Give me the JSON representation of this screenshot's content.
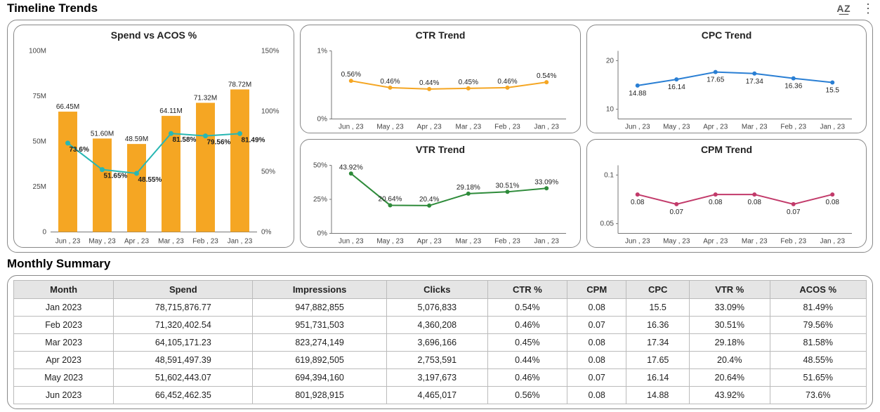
{
  "sections": {
    "trends_title": "Timeline Trends",
    "summary_title": "Monthly Summary"
  },
  "toolbar": {
    "sort_icon_label": "A͟Z",
    "more_icon_label": "⋮"
  },
  "table": {
    "headers": [
      "Month",
      "Spend",
      "Impressions",
      "Clicks",
      "CTR %",
      "CPM",
      "CPC",
      "VTR %",
      "ACOS %"
    ],
    "rows": [
      [
        "Jan 2023",
        "78,715,876.77",
        "947,882,855",
        "5,076,833",
        "0.54%",
        "0.08",
        "15.5",
        "33.09%",
        "81.49%"
      ],
      [
        "Feb 2023",
        "71,320,402.54",
        "951,731,503",
        "4,360,208",
        "0.46%",
        "0.07",
        "16.36",
        "30.51%",
        "79.56%"
      ],
      [
        "Mar 2023",
        "64,105,171.23",
        "823,274,149",
        "3,696,166",
        "0.45%",
        "0.08",
        "17.34",
        "29.18%",
        "81.58%"
      ],
      [
        "Apr 2023",
        "48,591,497.39",
        "619,892,505",
        "2,753,591",
        "0.44%",
        "0.08",
        "17.65",
        "20.4%",
        "48.55%"
      ],
      [
        "May 2023",
        "51,602,443.07",
        "694,394,160",
        "3,197,673",
        "0.46%",
        "0.07",
        "16.14",
        "20.64%",
        "51.65%"
      ],
      [
        "Jun 2023",
        "66,452,462.35",
        "801,928,915",
        "4,465,017",
        "0.56%",
        "0.08",
        "14.88",
        "43.92%",
        "73.6%"
      ]
    ]
  },
  "chart_data": [
    {
      "id": "ctr",
      "title": "CTR Trend",
      "type": "line",
      "color": "#f5a623",
      "categories": [
        "Jun , 23",
        "May , 23",
        "Apr , 23",
        "Mar , 23",
        "Feb , 23",
        "Jan , 23"
      ],
      "values": [
        0.56,
        0.46,
        0.44,
        0.45,
        0.46,
        0.54
      ],
      "value_labels": [
        "0.56%",
        "0.46%",
        "0.44%",
        "0.45%",
        "0.46%",
        "0.54%"
      ],
      "y_ticks": [
        0,
        1
      ],
      "y_tick_labels": [
        "0%",
        "1%"
      ],
      "ylim": [
        0,
        1
      ]
    },
    {
      "id": "cpc",
      "title": "CPC Trend",
      "type": "line",
      "color": "#2a7fd4",
      "categories": [
        "Jun , 23",
        "May , 23",
        "Apr , 23",
        "Mar , 23",
        "Feb , 23",
        "Jan , 23"
      ],
      "values": [
        14.88,
        16.14,
        17.65,
        17.34,
        16.36,
        15.5
      ],
      "value_labels": [
        "14.88",
        "16.14",
        "17.65",
        "17.34",
        "16.36",
        "15.5"
      ],
      "y_ticks": [
        10,
        20
      ],
      "y_tick_labels": [
        "10",
        "20"
      ],
      "ylim": [
        8,
        22
      ]
    },
    {
      "id": "vtr",
      "title": "VTR Trend",
      "type": "line",
      "color": "#2e8b3a",
      "categories": [
        "Jun , 23",
        "May , 23",
        "Apr , 23",
        "Mar , 23",
        "Feb , 23",
        "Jan , 23"
      ],
      "values": [
        43.92,
        20.64,
        20.4,
        29.18,
        30.51,
        33.09
      ],
      "value_labels": [
        "43.92%",
        "20.64%",
        "20.4%",
        "29.18%",
        "30.51%",
        "33.09%"
      ],
      "y_ticks": [
        0,
        25,
        50
      ],
      "y_tick_labels": [
        "0%",
        "25%",
        "50%"
      ],
      "ylim": [
        0,
        50
      ]
    },
    {
      "id": "cpm",
      "title": "CPM Trend",
      "type": "line",
      "color": "#c23a6a",
      "categories": [
        "Jun , 23",
        "May , 23",
        "Apr , 23",
        "Mar , 23",
        "Feb , 23",
        "Jan , 23"
      ],
      "values": [
        0.08,
        0.07,
        0.08,
        0.08,
        0.07,
        0.08
      ],
      "value_labels": [
        "0.08",
        "0.07",
        "0.08",
        "0.08",
        "0.07",
        "0.08"
      ],
      "y_ticks": [
        0.05,
        0.1
      ],
      "y_tick_labels": [
        "0.05",
        "0.1"
      ],
      "ylim": [
        0.04,
        0.11
      ]
    },
    {
      "id": "combo",
      "title": "Spend vs ACOS %",
      "type": "bar+line",
      "categories": [
        "Jun , 23",
        "May , 23",
        "Apr , 23",
        "Mar , 23",
        "Feb , 23",
        "Jan , 23"
      ],
      "bar_values": [
        66.45,
        51.6,
        48.59,
        64.11,
        71.32,
        78.72
      ],
      "bar_labels": [
        "66.45M",
        "51.60M",
        "48.59M",
        "64.11M",
        "71.32M",
        "78.72M"
      ],
      "bar_ylim": [
        0,
        100
      ],
      "bar_y_ticks": [
        0,
        25,
        50,
        75,
        100
      ],
      "bar_y_tick_labels": [
        "0",
        "25M",
        "50M",
        "75M",
        "100M"
      ],
      "line_values": [
        73.6,
        51.65,
        48.55,
        81.58,
        79.56,
        81.49
      ],
      "line_labels": [
        "73.6%",
        "51.65%",
        "48.55%",
        "81.58%",
        "79.56%",
        "81.49%"
      ],
      "line_ylim": [
        0,
        150
      ],
      "line_y_ticks": [
        0,
        50,
        100,
        150
      ],
      "line_y_tick_labels": [
        "0%",
        "50%",
        "100%",
        "150%"
      ]
    }
  ]
}
